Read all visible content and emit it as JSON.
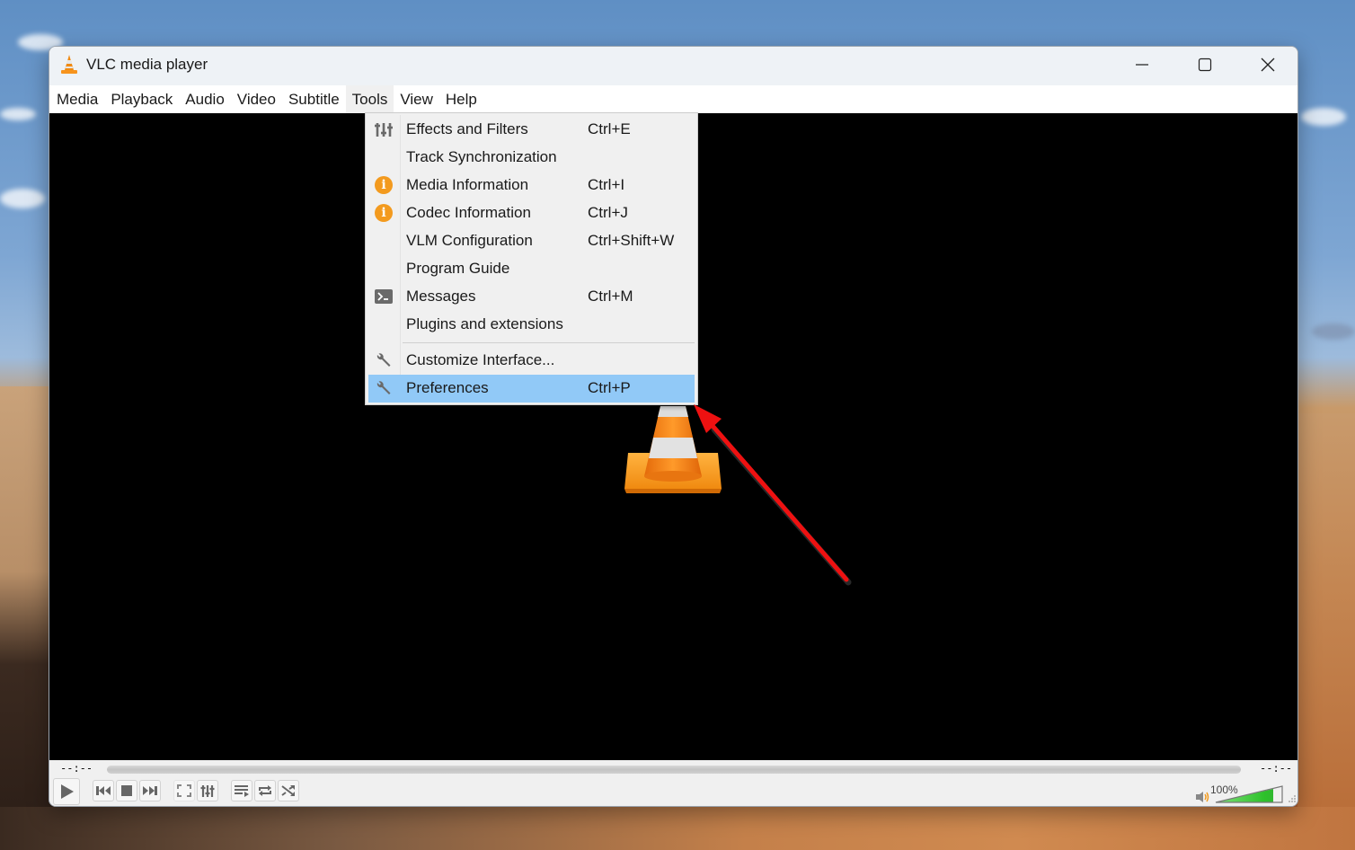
{
  "window": {
    "title": "VLC media player",
    "controls": {
      "minimize": "minimize",
      "maximize": "maximize",
      "close": "close"
    }
  },
  "menubar": {
    "items": [
      {
        "label": "Media"
      },
      {
        "label": "Playback"
      },
      {
        "label": "Audio"
      },
      {
        "label": "Video"
      },
      {
        "label": "Subtitle"
      },
      {
        "label": "Tools",
        "active": true
      },
      {
        "label": "View"
      },
      {
        "label": "Help"
      }
    ]
  },
  "tools_menu": {
    "items": [
      {
        "label": "Effects and Filters",
        "shortcut": "Ctrl+E",
        "icon": "equalizer-icon"
      },
      {
        "label": "Track Synchronization",
        "shortcut": "",
        "icon": ""
      },
      {
        "label": "Media Information",
        "shortcut": "Ctrl+I",
        "icon": "info-icon"
      },
      {
        "label": "Codec Information",
        "shortcut": "Ctrl+J",
        "icon": "info-icon"
      },
      {
        "label": "VLM Configuration",
        "shortcut": "Ctrl+Shift+W",
        "icon": ""
      },
      {
        "label": "Program Guide",
        "shortcut": "",
        "icon": ""
      },
      {
        "label": "Messages",
        "shortcut": "Ctrl+M",
        "icon": "terminal-icon"
      },
      {
        "label": "Plugins and extensions",
        "shortcut": "",
        "icon": ""
      },
      {
        "label": "Customize Interface...",
        "shortcut": "",
        "icon": "wrench-icon"
      },
      {
        "label": "Preferences",
        "shortcut": "Ctrl+P",
        "icon": "wrench-icon",
        "highlighted": true
      }
    ],
    "highlight_color": "#91c9f7"
  },
  "playback": {
    "elapsed": "--:--",
    "remaining": "--:--",
    "volume": "100%",
    "volume_level": 1.0
  },
  "annotation": {
    "arrow_color": "#ee1111",
    "points_to": "Preferences"
  }
}
